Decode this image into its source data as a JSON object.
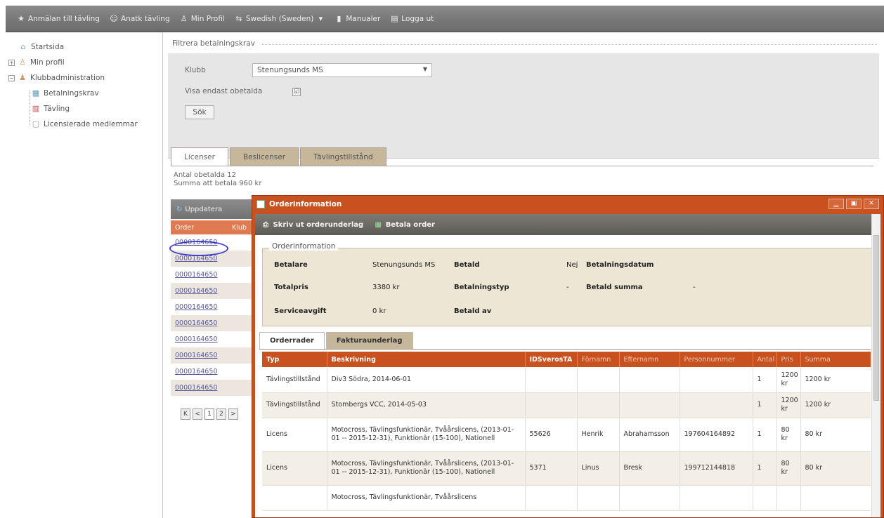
{
  "topbar": {
    "items": [
      {
        "icon": "star-icon",
        "label": "Anmälan till tävling"
      },
      {
        "icon": "people-icon",
        "label": "Anatk tävling"
      },
      {
        "icon": "user-icon",
        "label": "Min Profil"
      },
      {
        "icon": "language-icon",
        "label": "Swedish (Sweden)"
      },
      {
        "icon": "manual-icon",
        "label": "Manualer"
      },
      {
        "icon": "logout-icon",
        "label": "Logga ut"
      }
    ]
  },
  "tree": {
    "items": [
      {
        "label": "Startsida",
        "icon": "home-icon"
      },
      {
        "label": "Min profil",
        "icon": "user-icon"
      },
      {
        "label": "Klubbadministration",
        "icon": "club-icon"
      },
      {
        "label": "Betalningskrav",
        "icon": "payment-icon"
      },
      {
        "label": "Tävling",
        "icon": "calendar-icon"
      },
      {
        "label": "Licensierade medlemmar",
        "icon": "license-icon"
      }
    ]
  },
  "filter": {
    "legend": "Filtrera betalningskrav",
    "club_label": "Klubb",
    "club_value": "Stenungsunds MS",
    "unpaid_label": "Visa endast obetalda",
    "unpaid_mark": "☑",
    "search_button": "Sök"
  },
  "tabs": [
    "Licenser",
    "Beslicenser",
    "Tävlingstillstånd"
  ],
  "summary": {
    "count": "Antal obetalda 12",
    "total": "Summa att betala 960 kr"
  },
  "grid": {
    "refresh_label": "Uppdatera",
    "col_order": "Order",
    "col_club": "Klub",
    "orders": [
      "0000164650",
      "0000164650",
      "0000164650",
      "0000164650",
      "0000164650",
      "0000164650",
      "0000164650",
      "0000164650",
      "0000164650",
      "0000164650"
    ],
    "pager": [
      "K",
      "<",
      "1",
      "2",
      ">"
    ]
  },
  "dialog": {
    "title": "Orderinformation",
    "controls": [
      "▁",
      "▣",
      "✕"
    ],
    "print_label": "Skriv ut orderunderlag",
    "pay_label": "Betala order",
    "info_legend": "Orderinformation",
    "info": {
      "payer_k": "Betalare",
      "payer_v": "Stenungsunds MS",
      "paid_k": "Betald",
      "paid_v": "Nej",
      "paydate_k": "Betalningsdatum",
      "total_k": "Totalpris",
      "total_v": "3380 kr",
      "paytype_k": "Betalningstyp",
      "paytype_v": "-",
      "paidsum_k": "Betald summa",
      "paidsum_v": "-",
      "fee_k": "Serviceavgift",
      "fee_v": "0 kr",
      "paidby_k": "Betald av"
    },
    "tabs": [
      "Orderrader",
      "Fakturaunderlag"
    ],
    "columns": [
      "Typ",
      "Beskrivning",
      "IDSverosTA",
      "Förnamn",
      "Efternamn",
      "Personnummer",
      "Antal",
      "Pris",
      "Summa"
    ],
    "rows": [
      {
        "typ": "Tävlingstillstånd",
        "beskrivning": "Div3 Södra, 2014-06-01",
        "id": "",
        "fornamn": "",
        "efternamn": "",
        "pnr": "",
        "antal": "1",
        "pris": "1200 kr",
        "summa": "1200 kr"
      },
      {
        "typ": "Tävlingstillstånd",
        "beskrivning": "Stombergs VCC, 2014-05-03",
        "id": "",
        "fornamn": "",
        "efternamn": "",
        "pnr": "",
        "antal": "1",
        "pris": "1200 kr",
        "summa": "1200 kr"
      },
      {
        "typ": "Licens",
        "beskrivning": "Motocross, Tävlingsfunktionär, Tvåårslicens, (2013-01-01 -- 2015-12-31), Funktionär (15-100), Nationell",
        "id": "55626",
        "fornamn": "Henrik",
        "efternamn": "Abrahamsson",
        "pnr": "197604164892",
        "antal": "1",
        "pris": "80 kr",
        "summa": "80 kr"
      },
      {
        "typ": "Licens",
        "beskrivning": "Motocross, Tävlingsfunktionär, Tvåårslicens, (2013-01-01 -- 2015-12-31), Funktionär (15-100), Nationell",
        "id": "5371",
        "fornamn": "Linus",
        "efternamn": "Bresk",
        "pnr": "199712144818",
        "antal": "1",
        "pris": "80 kr",
        "summa": "80 kr"
      },
      {
        "typ": "",
        "beskrivning": "Motocross, Tävlingsfunktionär, Tvåårslicens",
        "id": "",
        "fornamn": "",
        "efternamn": "",
        "pnr": "",
        "antal": "",
        "pris": "",
        "summa": ""
      }
    ]
  }
}
